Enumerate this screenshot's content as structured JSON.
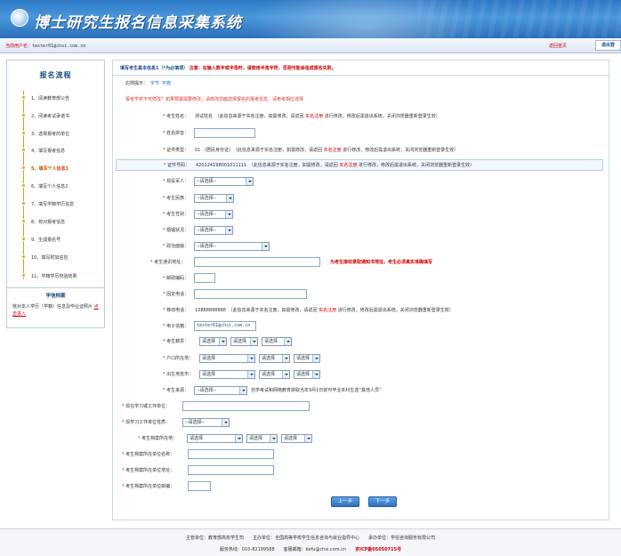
{
  "header": {
    "title": "博士研究生报名信息采集系统"
  },
  "userbar": {
    "prefix": "当前用户名：",
    "user": "tester01@chsi.com.cn",
    "home": "返回首页",
    "logout": "退出登"
  },
  "sidebar": {
    "title": "报名流程",
    "steps": [
      "1、阅读教育部公告",
      "2、阅读考试承诺书",
      "3、选择报考的单位",
      "4、填写报考信息",
      "5、填写个人信息1",
      "6、填写个人信息2",
      "7、填写学籍学历信息",
      "8、校对报考信息",
      "9、生成报名号",
      "10、填写附加信息",
      "11、学籍学历校验结果"
    ],
    "archive_title": "学信档案",
    "archive_text": "核对本人学历（学籍）信息及毕业证照片 ",
    "archive_link": "点击进入"
  },
  "main": {
    "heading": "填写考生基本信息1（*为必填项）",
    "heading_note": "注意：在输入数字或字母时，请使用半角字符，否则可能会造成报名失败。",
    "font_label": "右侧提示：",
    "font_a": "字节",
    "font_b": "字典",
    "warning": "报考学校不可修改！如果预报需要修改，请修改前面选择报名的报考信息，请参考相应选择",
    "name_label": "考生姓名：",
    "name_value": "测试姓名",
    "name_note": "（此信息来源于实名注册，如需修改，请返回 ",
    "realname": "实名注册",
    "name_tail": " 进行修改，修改后需退出系统，关闭浏览器重新登录生效）",
    "pinyin_label": "姓名拼音：",
    "idtype_label": "证件类型：",
    "idtype_value": "01 （居民身份证）",
    "idno_label": "证件号码：",
    "idno_value": "420124198001011111",
    "idno_note": "（此信息来源于实名注册，如需修改，请返回 ",
    "active_label": "现役军人：",
    "ethnic_label": "考生民族：",
    "gender_label": "考生性别：",
    "marital_label": "婚姻状况：",
    "politics_label": "政治面貌：",
    "address_label": "考生通讯地址：",
    "address_note": "为考生接收录取通知书地址，考生必须真实准确填写",
    "zip_label": "邮政编码：",
    "phone_label": "固定电话：",
    "mobile_label": "移动电话：",
    "mobile_value": "13888888888",
    "mobile_note": "（此信息来源于实名注册，如需修改，请返回 ",
    "email_label": "电子信箱：",
    "email_value": "tester01@chsi.com.cn",
    "origin_label": "考生籍贯：",
    "hukou_label": "户口所在地：",
    "birth_label": "出生地省市：",
    "source_label": "考生来源：",
    "source_note": "自学考试和网络教育获取当年9月1日前可毕业本科生选“其他人员”",
    "study_label": "现在学习或工作单位：",
    "study_type_label": "现学习工作单位性质：",
    "archive_place_label": "考生档案所在地：",
    "archive_unit_label": "考生档案所在单位名称：",
    "archive_addr_label": "考生档案所在单位地址：",
    "archive_zip_label": "考生档案所在单位邮编：",
    "please_select": "--请选择--",
    "please_select2": "请选择",
    "prev_button": "上一步",
    "next_button": "下一步"
  },
  "footer": {
    "line1": "主管单位：教育部高校学生司　　主办单位：全国高等学校学生信息咨询与就业指导中心　　承办单位：学信咨询服务有限公司",
    "line2_a": "服务热线：010-82199588　　客服邮箱：kefu@chsi.com.cn　　",
    "icp": "京ICP备05050715号"
  },
  "colors": {
    "banner": "#3a86d0",
    "accent": "#c00000",
    "link": "#1b6ac2"
  }
}
